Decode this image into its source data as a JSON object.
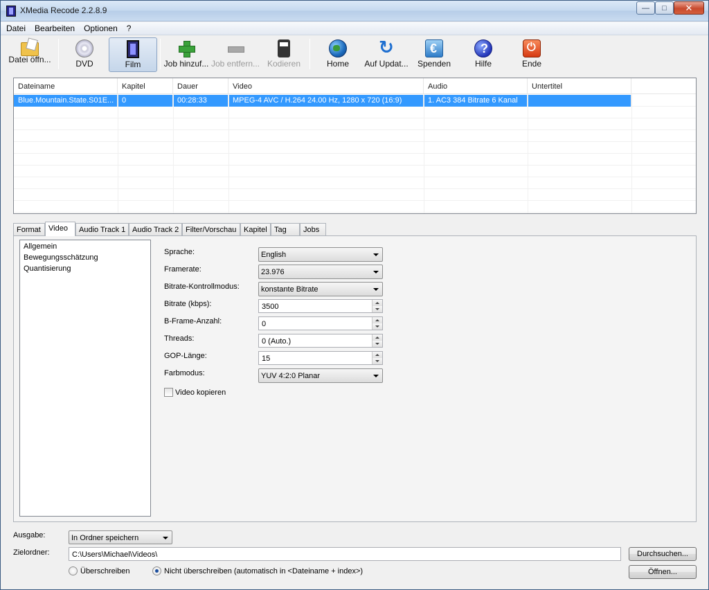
{
  "window": {
    "title": "XMedia Recode 2.2.8.9",
    "minimize_glyph": "—",
    "maximize_glyph": "□",
    "close_glyph": "✕"
  },
  "menu": [
    "Datei",
    "Bearbeiten",
    "Optionen",
    "?"
  ],
  "toolbar": {
    "open_file": "Datei öffn...",
    "dvd": "DVD",
    "film": "Film",
    "add_job": "Job hinzuf...",
    "remove_job": "Job entfern...",
    "encode": "Kodieren",
    "home": "Home",
    "update": "Auf Updat...",
    "donate": "Spenden",
    "help": "Hilfe",
    "exit": "Ende"
  },
  "filelist": {
    "columns": [
      "Dateiname",
      "Kapitel",
      "Dauer",
      "Video",
      "Audio",
      "Untertitel"
    ],
    "rows": [
      [
        "Blue.Mountain.State.S01E...",
        "0",
        "00:28:33",
        "MPEG-4 AVC / H.264 24.00 Hz, 1280 x 720 (16:9)",
        "1. AC3 384 Bitrate 6 Kanal",
        ""
      ]
    ]
  },
  "tabs": [
    "Format",
    "Video",
    "Audio Track 1",
    "Audio Track 2",
    "Filter/Vorschau",
    "Kapitel",
    "Tag",
    "Jobs"
  ],
  "active_tab": "Video",
  "tree": [
    "Allgemein",
    "Bewegungsschätzung",
    "Quantisierung"
  ],
  "video": {
    "sprache_label": "Sprache:",
    "sprache_value": "English",
    "framerate_label": "Framerate:",
    "framerate_value": "23.976",
    "bitratemode_label": "Bitrate-Kontrollmodus:",
    "bitratemode_value": "konstante Bitrate",
    "bitrate_label": "Bitrate (kbps):",
    "bitrate_value": "3500",
    "bframes_label": "B-Frame-Anzahl:",
    "bframes_value": "0",
    "threads_label": "Threads:",
    "threads_value": "0 (Auto.)",
    "gop_label": "GOP-Länge:",
    "gop_value": "15",
    "colormode_label": "Farbmodus:",
    "colormode_value": "YUV 4:2:0 Planar",
    "copy_label": "Video kopieren"
  },
  "output": {
    "ausgabe_label": "Ausgabe:",
    "ausgabe_value": "In Ordner speichern",
    "ziel_label": "Zielordner:",
    "ziel_value": "C:\\Users\\Michael\\Videos\\",
    "browse_label": "Durchsuchen...",
    "open_label": "Öffnen...",
    "overwrite_label": "Überschreiben",
    "no_overwrite_label": "Nicht überschreiben (automatisch in <Dateiname + index>)"
  }
}
